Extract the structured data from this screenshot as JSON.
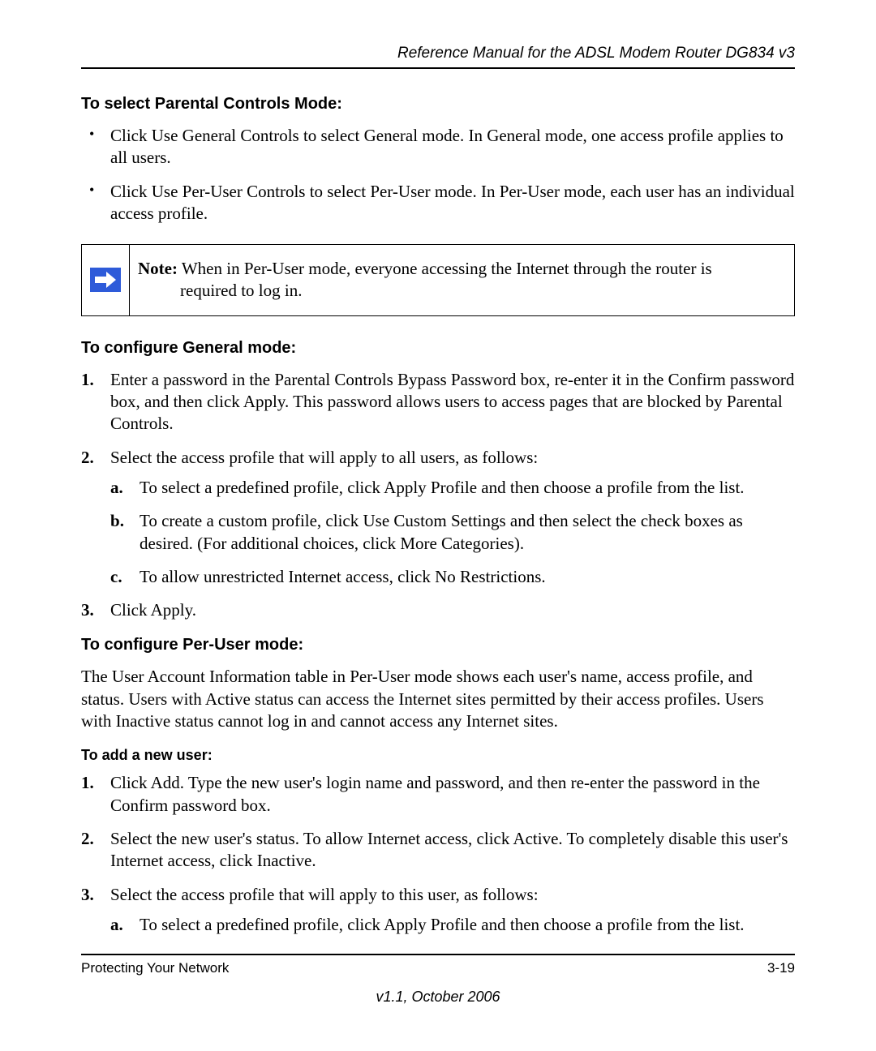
{
  "header": {
    "running_title": "Reference Manual for the ADSL Modem Router DG834 v3"
  },
  "section1": {
    "heading": "To select Parental Controls Mode:",
    "bullets": [
      "Click Use General Controls to select General mode. In General mode, one access profile applies to all users.",
      "Click Use Per-User Controls to select Per-User mode. In Per-User mode, each user has an individual access profile."
    ]
  },
  "note": {
    "label": "Note:",
    "line1": " When in Per-User mode, everyone accessing the Internet through the router is",
    "line2": "required to log in."
  },
  "section2": {
    "heading": "To configure General mode:",
    "items": [
      "Enter a password in the Parental Controls Bypass Password box, re-enter it in the Confirm password box, and then click Apply. This password allows users to access pages that are blocked by Parental Controls.",
      "Select the access profile that will apply to all users, as follows:",
      "Click Apply."
    ],
    "subitems_for_2": [
      "To select a predefined profile, click Apply Profile and then choose a profile from the list.",
      "To create a custom profile, click Use Custom Settings and then select the check boxes as desired. (For additional choices, click More Categories).",
      "To allow unrestricted Internet access, click No Restrictions."
    ]
  },
  "section3": {
    "heading": "To configure Per-User mode:",
    "intro": "The User Account Information table in Per-User mode shows each user's name, access profile, and status. Users with Active status can access the Internet sites permitted by their access profiles. Users with Inactive status cannot log in and cannot access any Internet sites.",
    "subhead": "To add a new user:",
    "items": [
      "Click Add. Type the new user's login name and password, and then re-enter the password in the Confirm password box.",
      "Select the new user's status. To allow Internet access, click Active. To completely disable this user's Internet access, click Inactive.",
      "Select the access profile that will apply to this user, as follows:"
    ],
    "subitems_for_3": [
      "To select a predefined profile, click Apply Profile and then choose a profile from the list."
    ]
  },
  "footer": {
    "left": "Protecting Your Network",
    "right": "3-19",
    "version": "v1.1, October 2006"
  }
}
